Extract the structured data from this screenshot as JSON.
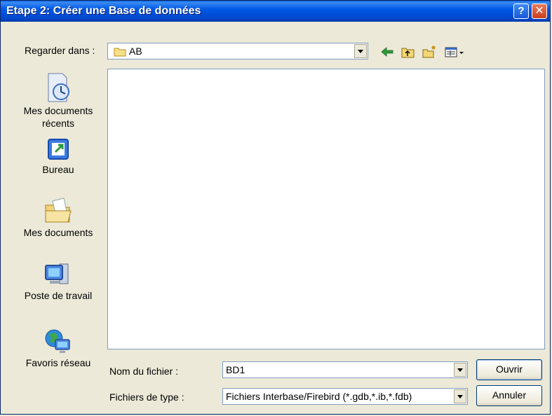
{
  "window": {
    "title": "Etape 2: Créer une Base de données",
    "help": "?",
    "close": "✕"
  },
  "lookin": {
    "label": "Regarder dans :",
    "value": "AB"
  },
  "toolbar": {
    "icons": [
      "back-arrow-icon",
      "up-folder-icon",
      "new-folder-icon",
      "view-menu-icon"
    ]
  },
  "places": [
    {
      "label": "Mes documents récents",
      "icon": "recent-documents-icon"
    },
    {
      "label": "Bureau",
      "icon": "desktop-icon"
    },
    {
      "label": "Mes documents",
      "icon": "my-documents-icon"
    },
    {
      "label": "Poste de travail",
      "icon": "my-computer-icon"
    },
    {
      "label": "Favoris réseau",
      "icon": "network-places-icon"
    }
  ],
  "filename": {
    "label": "Nom du fichier :",
    "value": "BD1"
  },
  "filetype": {
    "label": "Fichiers de type :",
    "value": "Fichiers Interbase/Firebird (*.gdb,*.ib,*.fdb)"
  },
  "buttons": {
    "open": "Ouvrir",
    "cancel": "Annuler"
  }
}
